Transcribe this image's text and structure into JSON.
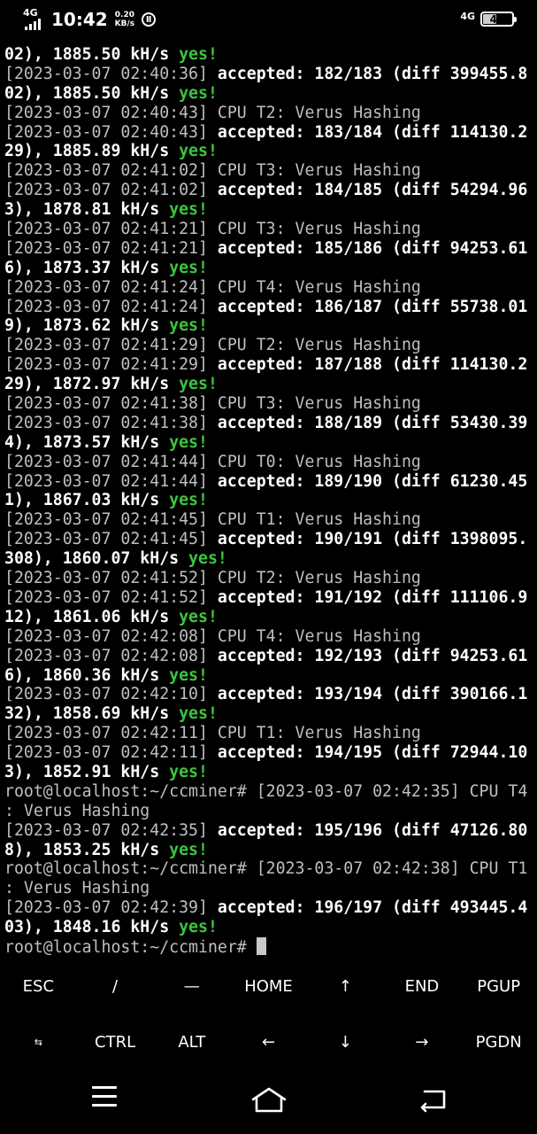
{
  "status_bar": {
    "network_left": "4G",
    "time": "10:42",
    "speed_value": "0.20",
    "speed_unit": "KB/s",
    "network_right": "4G",
    "battery": "47"
  },
  "terminal": {
    "lines": [
      [
        {
          "t": "02), 1885.50 kH/s ",
          "c": "b"
        },
        {
          "t": "yes!",
          "c": "yes"
        }
      ],
      [
        {
          "t": "[2023-03-07 02:40:36] ",
          "c": "ts"
        },
        {
          "t": "accepted: 182/183 (diff 399455.8",
          "c": "b"
        }
      ],
      [
        {
          "t": "02), 1885.50 kH/s ",
          "c": "b"
        },
        {
          "t": "yes!",
          "c": "yes"
        }
      ],
      [
        {
          "t": "[2023-03-07 02:40:43] ",
          "c": "ts"
        },
        {
          "t": "CPU T2: Verus Hashing",
          "c": "plain"
        }
      ],
      [
        {
          "t": "[2023-03-07 02:40:43] ",
          "c": "ts"
        },
        {
          "t": "accepted: 183/184 (diff 114130.2",
          "c": "b"
        }
      ],
      [
        {
          "t": "29), 1885.89 kH/s ",
          "c": "b"
        },
        {
          "t": "yes!",
          "c": "yes"
        }
      ],
      [
        {
          "t": "[2023-03-07 02:41:02] ",
          "c": "ts"
        },
        {
          "t": "CPU T3: Verus Hashing",
          "c": "plain"
        }
      ],
      [
        {
          "t": "[2023-03-07 02:41:02] ",
          "c": "ts"
        },
        {
          "t": "accepted: 184/185 (diff 54294.96",
          "c": "b"
        }
      ],
      [
        {
          "t": "3), 1878.81 kH/s ",
          "c": "b"
        },
        {
          "t": "yes!",
          "c": "yes"
        }
      ],
      [
        {
          "t": "[2023-03-07 02:41:21] ",
          "c": "ts"
        },
        {
          "t": "CPU T3: Verus Hashing",
          "c": "plain"
        }
      ],
      [
        {
          "t": "[2023-03-07 02:41:21] ",
          "c": "ts"
        },
        {
          "t": "accepted: 185/186 (diff 94253.61",
          "c": "b"
        }
      ],
      [
        {
          "t": "6), 1873.37 kH/s ",
          "c": "b"
        },
        {
          "t": "yes!",
          "c": "yes"
        }
      ],
      [
        {
          "t": "[2023-03-07 02:41:24] ",
          "c": "ts"
        },
        {
          "t": "CPU T4: Verus Hashing",
          "c": "plain"
        }
      ],
      [
        {
          "t": "[2023-03-07 02:41:24] ",
          "c": "ts"
        },
        {
          "t": "accepted: 186/187 (diff 55738.01",
          "c": "b"
        }
      ],
      [
        {
          "t": "9), 1873.62 kH/s ",
          "c": "b"
        },
        {
          "t": "yes!",
          "c": "yes"
        }
      ],
      [
        {
          "t": "[2023-03-07 02:41:29] ",
          "c": "ts"
        },
        {
          "t": "CPU T2: Verus Hashing",
          "c": "plain"
        }
      ],
      [
        {
          "t": "[2023-03-07 02:41:29] ",
          "c": "ts"
        },
        {
          "t": "accepted: 187/188 (diff 114130.2",
          "c": "b"
        }
      ],
      [
        {
          "t": "29), 1872.97 kH/s ",
          "c": "b"
        },
        {
          "t": "yes!",
          "c": "yes"
        }
      ],
      [
        {
          "t": "[2023-03-07 02:41:38] ",
          "c": "ts"
        },
        {
          "t": "CPU T3: Verus Hashing",
          "c": "plain"
        }
      ],
      [
        {
          "t": "[2023-03-07 02:41:38] ",
          "c": "ts"
        },
        {
          "t": "accepted: 188/189 (diff 53430.39",
          "c": "b"
        }
      ],
      [
        {
          "t": "4), 1873.57 kH/s ",
          "c": "b"
        },
        {
          "t": "yes!",
          "c": "yes"
        }
      ],
      [
        {
          "t": "[2023-03-07 02:41:44] ",
          "c": "ts"
        },
        {
          "t": "CPU T0: Verus Hashing",
          "c": "plain"
        }
      ],
      [
        {
          "t": "[2023-03-07 02:41:44] ",
          "c": "ts"
        },
        {
          "t": "accepted: 189/190 (diff 61230.45",
          "c": "b"
        }
      ],
      [
        {
          "t": "1), 1867.03 kH/s ",
          "c": "b"
        },
        {
          "t": "yes!",
          "c": "yes"
        }
      ],
      [
        {
          "t": "[2023-03-07 02:41:45] ",
          "c": "ts"
        },
        {
          "t": "CPU T1: Verus Hashing",
          "c": "plain"
        }
      ],
      [
        {
          "t": "[2023-03-07 02:41:45] ",
          "c": "ts"
        },
        {
          "t": "accepted: 190/191 (diff 1398095.",
          "c": "b"
        }
      ],
      [
        {
          "t": "308), 1860.07 kH/s ",
          "c": "b"
        },
        {
          "t": "yes!",
          "c": "yes"
        }
      ],
      [
        {
          "t": "[2023-03-07 02:41:52] ",
          "c": "ts"
        },
        {
          "t": "CPU T2: Verus Hashing",
          "c": "plain"
        }
      ],
      [
        {
          "t": "[2023-03-07 02:41:52] ",
          "c": "ts"
        },
        {
          "t": "accepted: 191/192 (diff 111106.9",
          "c": "b"
        }
      ],
      [
        {
          "t": "12), 1861.06 kH/s ",
          "c": "b"
        },
        {
          "t": "yes!",
          "c": "yes"
        }
      ],
      [
        {
          "t": "[2023-03-07 02:42:08] ",
          "c": "ts"
        },
        {
          "t": "CPU T4: Verus Hashing",
          "c": "plain"
        }
      ],
      [
        {
          "t": "[2023-03-07 02:42:08] ",
          "c": "ts"
        },
        {
          "t": "accepted: 192/193 (diff 94253.61",
          "c": "b"
        }
      ],
      [
        {
          "t": "6), 1860.36 kH/s ",
          "c": "b"
        },
        {
          "t": "yes!",
          "c": "yes"
        }
      ],
      [
        {
          "t": "[2023-03-07 02:42:10] ",
          "c": "ts"
        },
        {
          "t": "accepted: 193/194 (diff 390166.1",
          "c": "b"
        }
      ],
      [
        {
          "t": "32), 1858.69 kH/s ",
          "c": "b"
        },
        {
          "t": "yes!",
          "c": "yes"
        }
      ],
      [
        {
          "t": "[2023-03-07 02:42:11] ",
          "c": "ts"
        },
        {
          "t": "CPU T1: Verus Hashing",
          "c": "plain"
        }
      ],
      [
        {
          "t": "[2023-03-07 02:42:11] ",
          "c": "ts"
        },
        {
          "t": "accepted: 194/195 (diff 72944.10",
          "c": "b"
        }
      ],
      [
        {
          "t": "3), 1852.91 kH/s ",
          "c": "b"
        },
        {
          "t": "yes!",
          "c": "yes"
        }
      ],
      [
        {
          "t": "root@localhost:~/ccminer# [2023-03-07 02:42:35] CPU T4",
          "c": "plain"
        }
      ],
      [
        {
          "t": ": Verus Hashing",
          "c": "plain"
        }
      ],
      [
        {
          "t": "[2023-03-07 02:42:35] ",
          "c": "ts"
        },
        {
          "t": "accepted: 195/196 (diff 47126.80",
          "c": "b"
        }
      ],
      [
        {
          "t": "8), 1853.25 kH/s ",
          "c": "b"
        },
        {
          "t": "yes!",
          "c": "yes"
        }
      ],
      [
        {
          "t": "root@localhost:~/ccminer# [2023-03-07 02:42:38] CPU T1",
          "c": "plain"
        }
      ],
      [
        {
          "t": ": Verus Hashing",
          "c": "plain"
        }
      ],
      [
        {
          "t": "[2023-03-07 02:42:39] ",
          "c": "ts"
        },
        {
          "t": "accepted: 196/197 (diff 493445.4",
          "c": "b"
        }
      ],
      [
        {
          "t": "03), 1848.16 kH/s ",
          "c": "b"
        },
        {
          "t": "yes!",
          "c": "yes"
        }
      ]
    ],
    "prompt": "root@localhost:~/ccminer# "
  },
  "extra_keys": {
    "row1": [
      "ESC",
      "/",
      "—",
      "HOME",
      "↑",
      "END",
      "PGUP"
    ],
    "row2": [
      "⇆",
      "CTRL",
      "ALT",
      "←",
      "↓",
      "→",
      "PGDN"
    ]
  },
  "colors": {
    "background": "#000000",
    "timestamp": "#bfbfbf",
    "yes": "#3ec43e"
  }
}
